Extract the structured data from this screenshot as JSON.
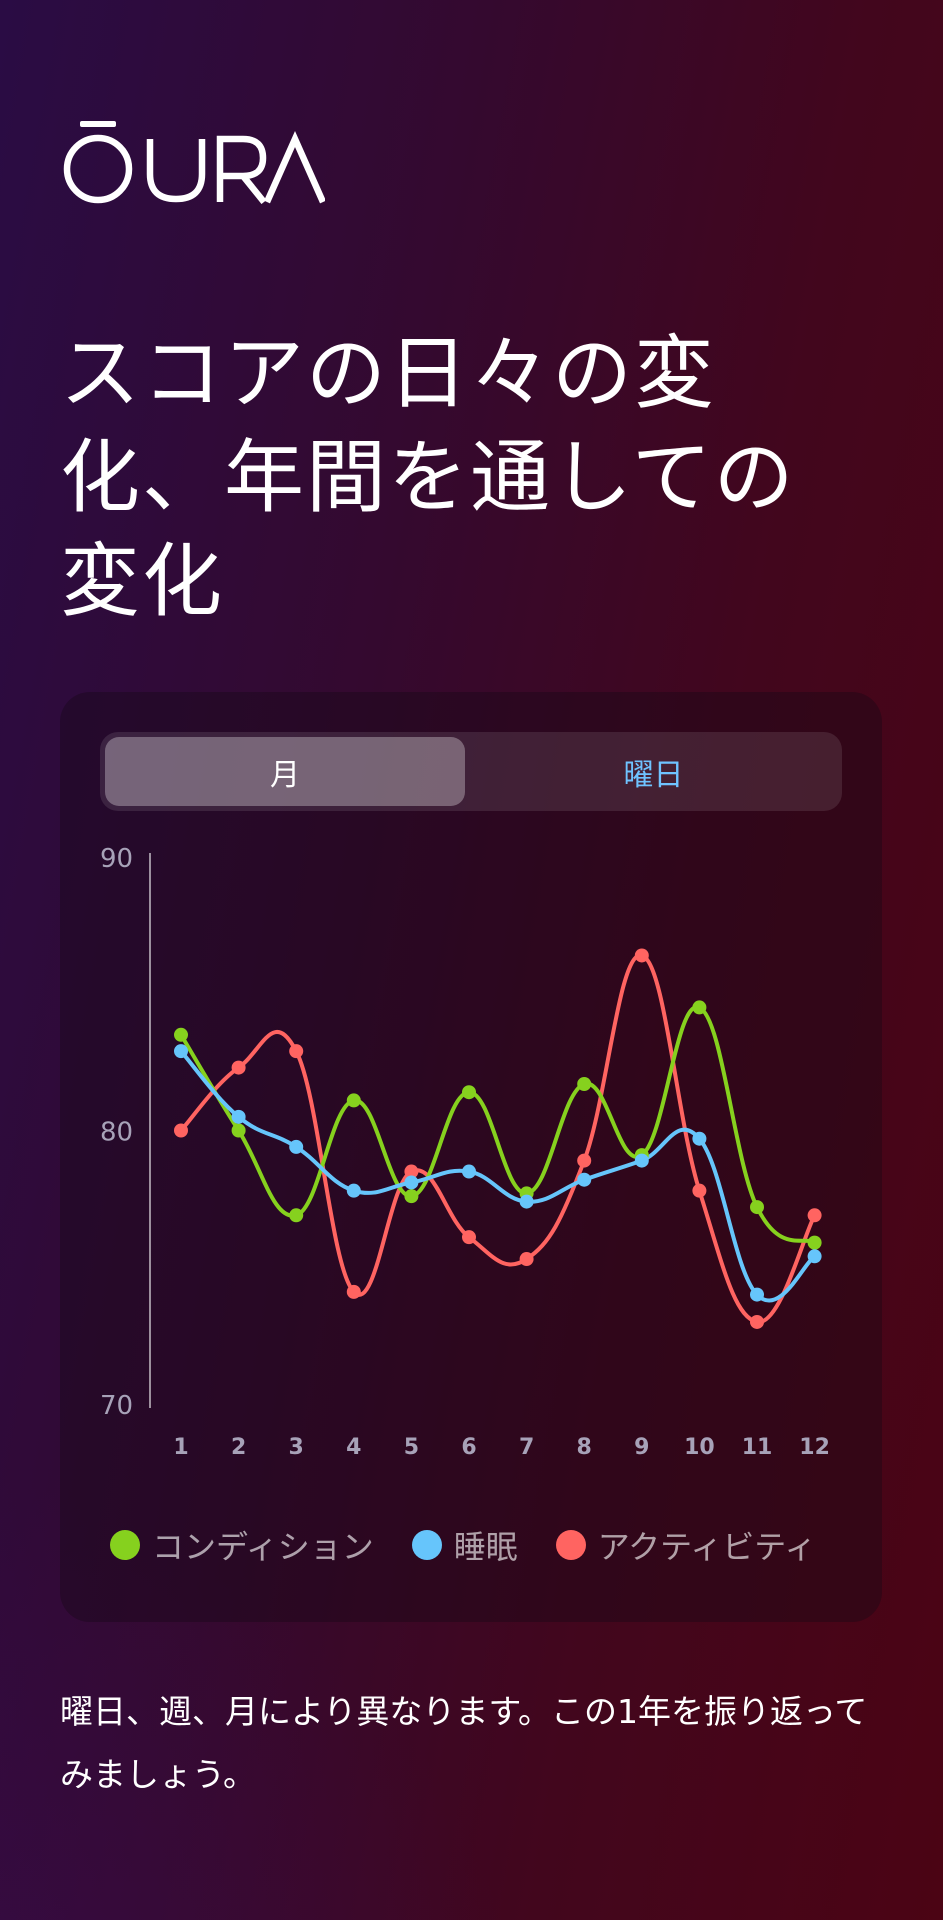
{
  "brand": {
    "name": "ŌURA"
  },
  "headline": "スコアの日々の変化、年間を通しての変化",
  "segmented_control": {
    "options": [
      "月",
      "曜日"
    ],
    "selected": "月"
  },
  "body_text": "曜日、週、月により異なります。この1年を振り返ってみましょう。",
  "colors": {
    "condition": "#86d11e",
    "sleep": "#66c5fb",
    "activity": "#ff6461",
    "axis_label": "#a7a2b8"
  },
  "chart_data": {
    "type": "line",
    "title": "",
    "xlabel": "",
    "ylabel": "",
    "x": [
      1,
      2,
      3,
      4,
      5,
      6,
      7,
      8,
      9,
      10,
      11,
      12
    ],
    "ylim": [
      70,
      90
    ],
    "yticks": [
      90,
      80,
      70
    ],
    "grid": false,
    "legend_position": "bottom",
    "series": [
      {
        "name": "コンディション",
        "color": "#86d11e",
        "values": [
          83.5,
          80.0,
          76.9,
          81.1,
          77.6,
          81.4,
          77.7,
          81.7,
          79.1,
          84.5,
          77.2,
          75.9
        ]
      },
      {
        "name": "睡眠",
        "color": "#66c5fb",
        "values": [
          82.9,
          80.5,
          79.4,
          77.8,
          78.1,
          78.5,
          77.4,
          78.2,
          78.9,
          79.7,
          74.0,
          75.4
        ]
      },
      {
        "name": "アクティビティ",
        "color": "#ff6461",
        "values": [
          80.0,
          82.3,
          82.9,
          74.1,
          78.5,
          76.1,
          75.3,
          78.9,
          86.4,
          77.8,
          73.0,
          76.9
        ]
      }
    ]
  }
}
